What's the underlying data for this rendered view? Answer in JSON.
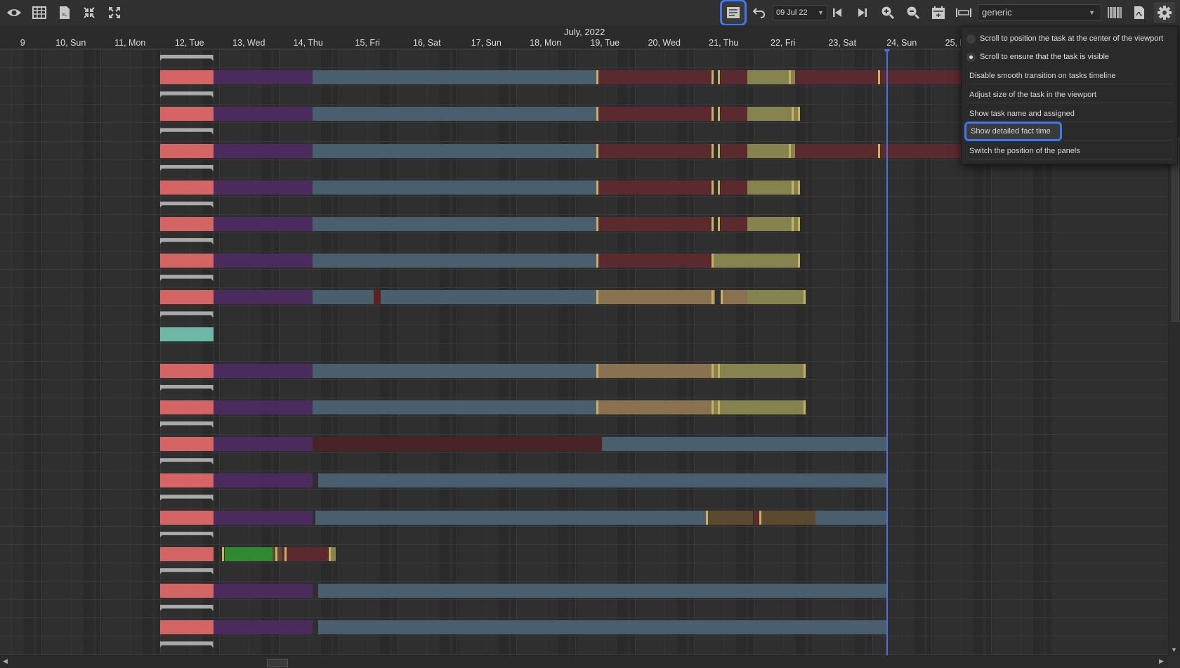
{
  "toolbar": {
    "left_icons": [
      "eye-icon",
      "grid-icon",
      "excel-icon",
      "collapse-icon",
      "expand-icon"
    ],
    "right_icons": [
      "list-icon",
      "undo-icon",
      "first-page-icon",
      "last-page-icon",
      "zoom-in-icon",
      "zoom-out-icon",
      "calendar-icon",
      "fit-width-icon",
      "barcode-icon",
      "pdf-icon",
      "gear-icon"
    ],
    "date_value": "09 Jul 22",
    "profile_value": "generic"
  },
  "timeline": {
    "month": "July, 2022",
    "days": [
      "9",
      "10, Sun",
      "11, Mon",
      "12, Tue",
      "13, Wed",
      "14, Thu",
      "15, Fri",
      "16, Sat",
      "17, Sun",
      "18, Mon",
      "19, Tue",
      "20, Wed",
      "21, Thu",
      "22, Fri",
      "23, Sat",
      "24, Sun",
      "25, Mon"
    ]
  },
  "settings_menu": {
    "scroll_center": "Scroll to position the task at the center of the viewport",
    "scroll_visible": "Scroll to ensure that the task is visible",
    "scroll_mode_selected": "visible",
    "disable_smooth": "Disable smooth transition on tasks timeline",
    "adjust_size": "Adjust size of the task in the viewport",
    "show_name": "Show task name and assigned",
    "show_fact_time": "Show detailed fact time",
    "switch_panels": "Switch the position of the panels"
  },
  "colors": {
    "purple": "#4b2b5e",
    "steel": "#4a5f6e",
    "maroon": "#5a2a2f",
    "olive": "#86844e",
    "tan": "#8a7250",
    "brown": "#5c4a30",
    "green": "#2f8a2f",
    "salmon": "#d56565",
    "teal": "#6fb8a8",
    "gray": "#a9a9a9",
    "accent": "#3d78f2"
  }
}
